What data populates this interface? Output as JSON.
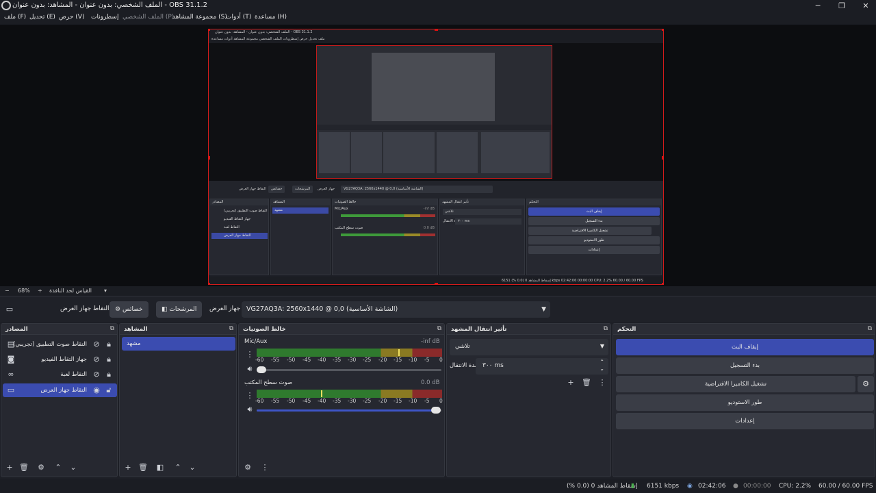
{
  "window": {
    "title": "الملف الشخصي: بدون عنوان - المشاهد: بدون عنوان - OBS 31.1.2",
    "minimize": "─",
    "maximize": "❐",
    "close": "✕"
  },
  "menu": {
    "file": "ملف (F)",
    "edit": "تحديل (E)",
    "view": "حرض (V)",
    "docks": "إسطرونات",
    "profile": "الملف الشخصي (P)",
    "scene_collection": "مجموعة المشاهد (S)",
    "tools": "أدوات (T)",
    "help": "مساعدة (H)"
  },
  "mini": {
    "title": "الملف الشخصي: بدون عنوان - المشاهد: بدون عنوان - OBS 31.1.2",
    "menu": "ملف   تحديل   حرض   إسطرونات   الملف الشخصي   مجموعة المشاهد   أدوات   مساعدة",
    "capture": "التقاط جهاز العرض",
    "props": "خصائص",
    "filters": "المرشحات",
    "device": "جهاز العرض",
    "combo": "VG27AQ3A: 2560x1440 @ 0,0 (الشاشة الأساسية)",
    "sources_title": "المصادر",
    "scenes_title": "المشاهد",
    "mixer_title": "خالط الصوتيات",
    "trans_title": "تأثير انتقال المشهد",
    "controls_title": "التحكم",
    "src1": "التقاط صوت التطبيق (تجريبي)",
    "src2": "جهاز التقاط الفيديو",
    "src3": "التقاط لعبة",
    "src4": "التقاط جهاز العرض",
    "scene1": "مشهد",
    "mic": "Mic/Aux",
    "desk": "صوت سطح المكتب",
    "db1": "-inf dB",
    "db2": "0.0 dB",
    "fade": "تلاشي",
    "duration_label": "مدة الانتقال",
    "duration": "٣٠٠ ms",
    "c1": "إيقاف البث",
    "c2": "بدء التسجيل",
    "c3": "تشغيل الكاميرا الافتراضية",
    "c4": "طور الاستوديو",
    "c5": "إعدادات",
    "status": "إسقاط المشاهد 0 (0.0 %)     6151 kbps     02:42:06     00:00:00     CPU: 2.2%    60.00 / 60.00 FPS"
  },
  "zoom": {
    "minus": "−",
    "value": "68%",
    "plus": "+",
    "fit_label": "القياس لحد النافذة",
    "dropdown": "▾"
  },
  "source_bar": {
    "capture_label": "التقاط جهاز العرض",
    "properties": "خصائص",
    "filters": "المرشحات",
    "device_label": "جهاز العرض",
    "device_value": "VG27AQ3A: 2560x1440 @ 0,0 (الشاشة الأساسية)"
  },
  "sources": {
    "title": "المصادر",
    "items": [
      {
        "name": "التقاط صوت التطبيق (تجريبي)",
        "type_icon": "app-audio-icon"
      },
      {
        "name": "جهاز التقاط الفيديو",
        "type_icon": "camera-icon"
      },
      {
        "name": "التقاط لعبة",
        "type_icon": "gamepad-icon"
      },
      {
        "name": "التقاط جهاز العرض",
        "type_icon": "monitor-icon"
      }
    ]
  },
  "scenes": {
    "title": "المشاهد",
    "items": [
      "مشهد"
    ]
  },
  "mixer": {
    "title": "خالط الصوتيات",
    "channels": [
      {
        "name": "Mic/Aux",
        "db": "-inf dB"
      },
      {
        "name": "صوت سطح المكتب",
        "db": "0.0 dB"
      }
    ],
    "scale": [
      "-60",
      "-55",
      "-50",
      "-45",
      "-40",
      "-35",
      "-30",
      "-25",
      "-20",
      "-15",
      "-10",
      "-5",
      "0"
    ]
  },
  "transitions": {
    "title": "تأثير انتقال المشهد",
    "selected": "تلاشي",
    "duration_label": "مدة الانتقال",
    "duration_value": "٣٠٠ ms"
  },
  "controls": {
    "title": "التحكم",
    "stop_stream": "إيقاف البث",
    "start_recording": "بدء التسجيل",
    "virtual_camera": "تشغيل الكاميرا الافتراضية",
    "studio_mode": "طور الاستوديو",
    "settings": "إعدادات"
  },
  "status": {
    "dropped": "إسقاط المشاهد 0 (0.0 %)",
    "bitrate": "6151 kbps",
    "stream_time": "02:42:06",
    "rec_time": "00:00:00",
    "cpu": "CPU: 2.2%",
    "fps": "60.00 / 60.00 FPS"
  },
  "colors": {
    "accent": "#3b4cb0",
    "preview_border": "#d31b1b",
    "meter_green": "#2f7a2e",
    "meter_yellow": "#8a7a22",
    "meter_red": "#8a2a2a"
  }
}
